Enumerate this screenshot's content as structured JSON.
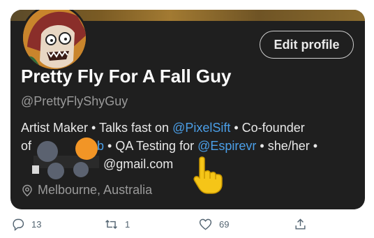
{
  "profile": {
    "display_name": "Pretty Fly For A Fall Guy",
    "handle": "@PrettyFlyShyGuy",
    "edit_button": "Edit profile",
    "bio": {
      "line1_a": "Artist ",
      "line1_b": " Maker • Talks fast on ",
      "line1_link": "@PixelSift",
      "line1_c": " • Co-founder",
      "line2_a": "of ",
      "line2_link1": "Fab",
      "line2_b": " • QA Testing for ",
      "line2_link2": "@Espirevr",
      "line2_c": " • she/her •",
      "line3": "@gmail.com"
    },
    "location": "Melbourne, Australia"
  },
  "actions": {
    "replies": "13",
    "retweets": "1",
    "likes": "69"
  },
  "colors": {
    "card_background": "#1f1f1f",
    "link": "#4b9fe8",
    "muted_text": "#9a9a9a"
  }
}
